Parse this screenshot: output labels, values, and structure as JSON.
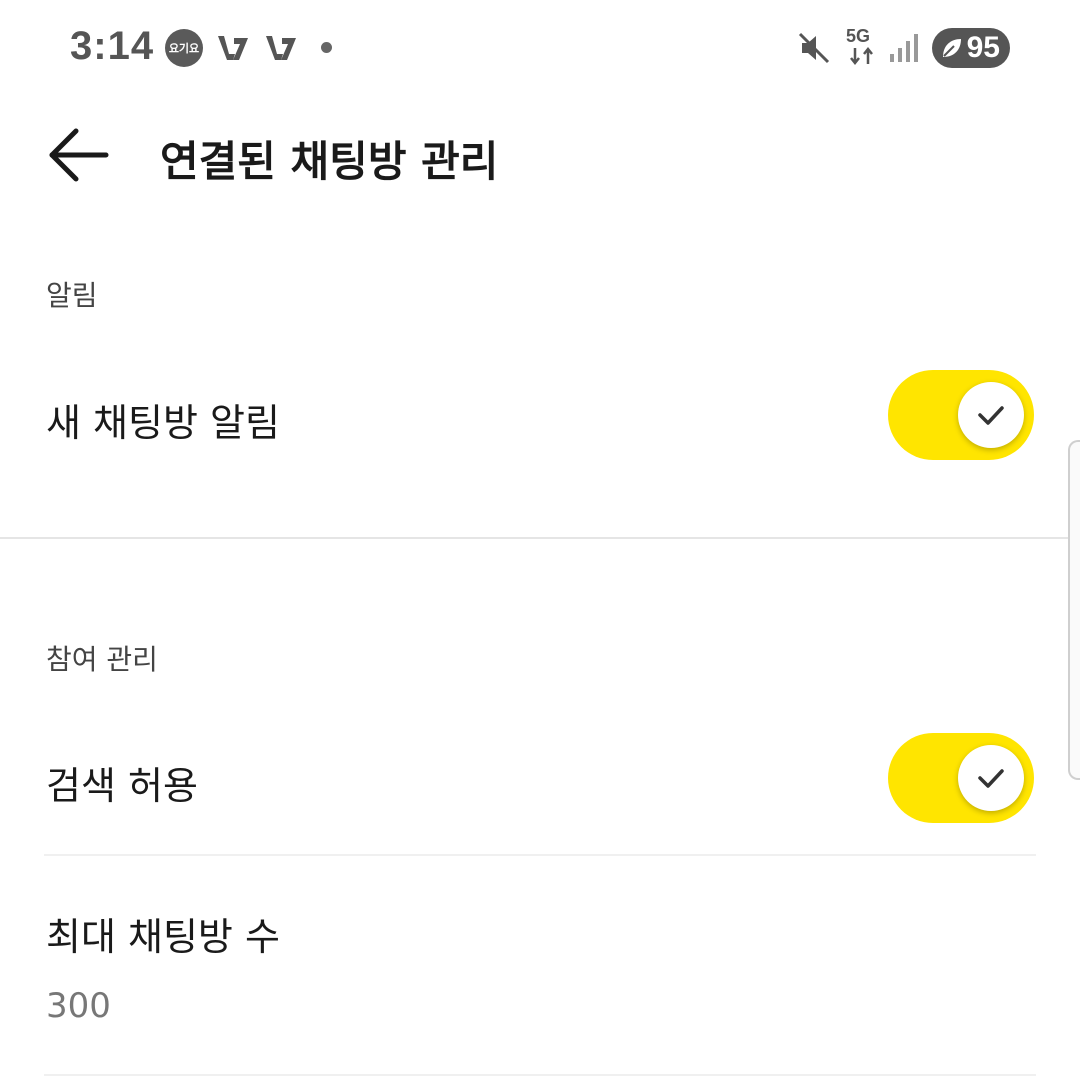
{
  "status_bar": {
    "time": "3:14",
    "app_badge_text": "요기요",
    "network": "5G",
    "battery_percent": "95"
  },
  "header": {
    "title": "연결된 채팅방 관리",
    "back_icon": "arrow-left-icon"
  },
  "sections": {
    "notifications": {
      "header": "알림",
      "new_chat_alert": {
        "label": "새 채팅방 알림",
        "enabled": true
      }
    },
    "participation": {
      "header": "참여 관리",
      "allow_search": {
        "label": "검색 허용",
        "enabled": true
      },
      "max_rooms": {
        "label": "최대 채팅방 수",
        "value": "300"
      }
    }
  },
  "colors": {
    "toggle_on": "#ffe500",
    "text_primary": "#1a1a1a",
    "text_secondary": "#777777"
  }
}
